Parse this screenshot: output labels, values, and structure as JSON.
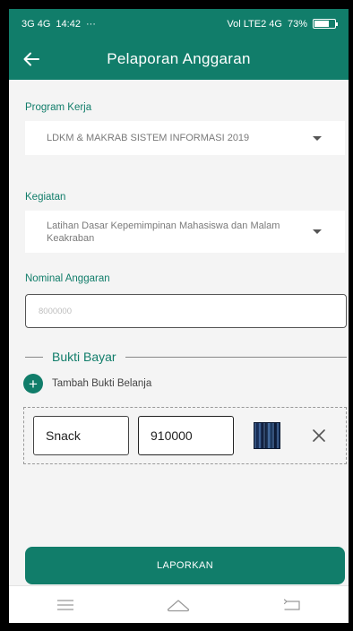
{
  "status_bar": {
    "network_left": "3G 4G",
    "time": "14:42",
    "extras": "···",
    "network_right": "Vol LTE2 4G",
    "battery": "73%",
    "battery_level": 0.73
  },
  "app_bar": {
    "back_icon": "arrow-left-icon",
    "title": "Pelaporan Anggaran"
  },
  "form": {
    "program_label": "Program Kerja",
    "program_value": "LDKM & MAKRAB SISTEM INFORMASI 2019",
    "kegiatan_label": "Kegiatan",
    "kegiatan_value": "Latihan Dasar Kepemimpinan Mahasiswa dan Malam Keakraban",
    "nominal_label": "Nominal Anggaran",
    "nominal_placeholder": "8000000",
    "nominal_value": ""
  },
  "bukti": {
    "section_title": "Bukti Bayar",
    "add_label": "Tambah Bukti Belanja",
    "add_icon": "plus-icon",
    "items": [
      {
        "name": "Snack",
        "amount": "910000",
        "thumb_icon": "receipt-thumbnail",
        "remove_icon": "close-icon"
      }
    ]
  },
  "submit_label": "LAPORKAN",
  "nav": {
    "menu_icon": "menu-icon",
    "home_icon": "home-icon",
    "back_icon": "back-icon"
  },
  "colors": {
    "primary": "#117d6a",
    "background": "#f4f4f4"
  }
}
